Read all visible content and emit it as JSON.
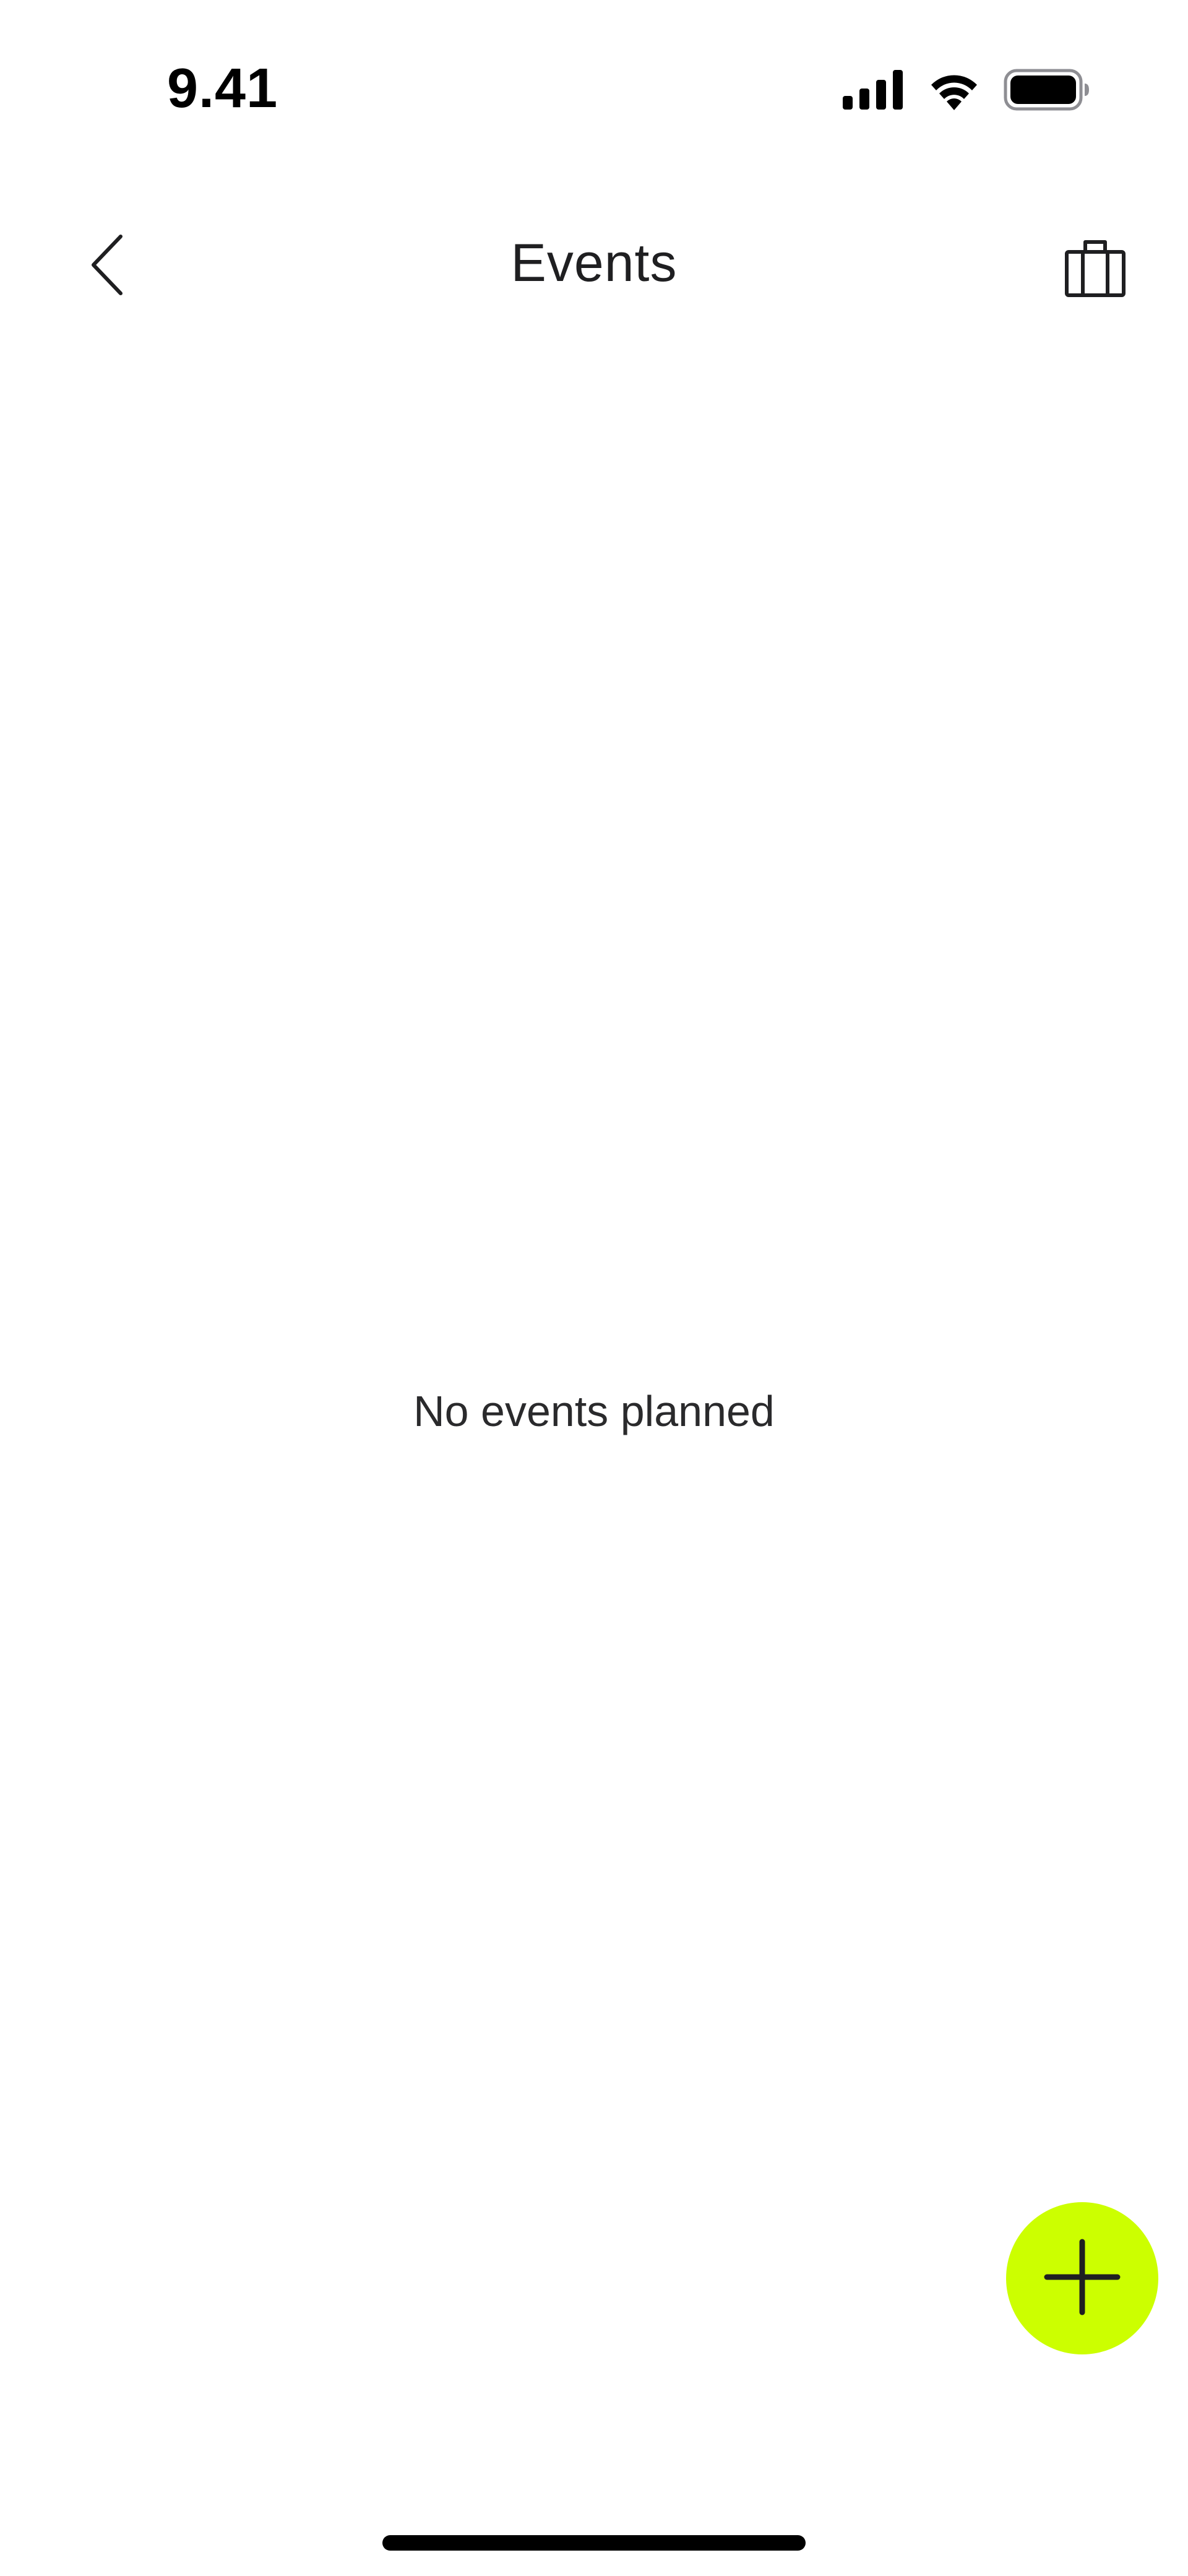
{
  "status_bar": {
    "time": "9.41",
    "icons": [
      "cellular-signal-icon",
      "wifi-icon",
      "battery-icon"
    ]
  },
  "header": {
    "title": "Events",
    "back_icon": "chevron-left-icon",
    "action_icon": "suitcase-icon"
  },
  "main": {
    "empty_message": "No events planned"
  },
  "fab": {
    "icon": "plus-icon",
    "color": "#CCFF00"
  },
  "colors": {
    "accent": "#CCFF00",
    "text": "#1F1F21",
    "background": "#FFFFFF"
  }
}
